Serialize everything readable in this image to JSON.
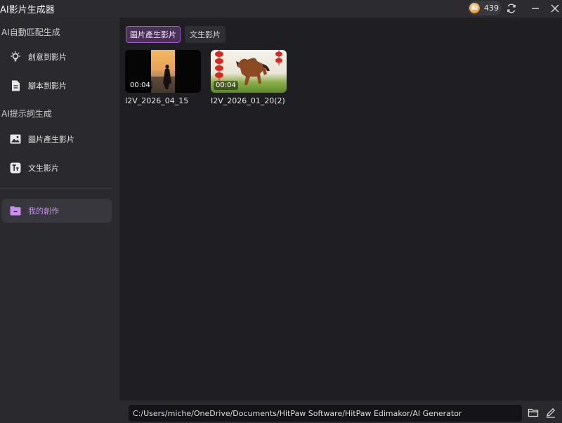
{
  "window": {
    "title": "AI影片生成器",
    "credits": "439",
    "coin_label": "AI"
  },
  "sidebar": {
    "section1_title": "AI自動匹配生成",
    "section2_title": "AI提示詞生成",
    "items": [
      {
        "label": "創意到影片",
        "icon": "lightbulb-icon"
      },
      {
        "label": "腳本到影片",
        "icon": "document-icon"
      },
      {
        "label": "圖片產生影片",
        "icon": "image-icon"
      },
      {
        "label": "文生影片",
        "icon": "text-icon"
      },
      {
        "label": "我的創作",
        "icon": "folder-icon",
        "active": true
      }
    ]
  },
  "main": {
    "tabs": [
      {
        "label": "圖片產生影片",
        "active": true
      },
      {
        "label": "文生影片",
        "active": false
      }
    ],
    "videos": [
      {
        "name": "I2V_2026_04_15",
        "duration": "00:04"
      },
      {
        "name": "I2V_2026_01_20(2)",
        "duration": "00:04"
      }
    ]
  },
  "bottom": {
    "path": "C:/Users/miche/OneDrive/Documents/HitPaw Software/HitPaw Edimakor/AI Generator"
  },
  "colors": {
    "accent": "#c98df2",
    "accent_bg": "#4a2f56",
    "sidebar_bg": "#2a2a2e",
    "main_bg": "#1f1e23"
  }
}
